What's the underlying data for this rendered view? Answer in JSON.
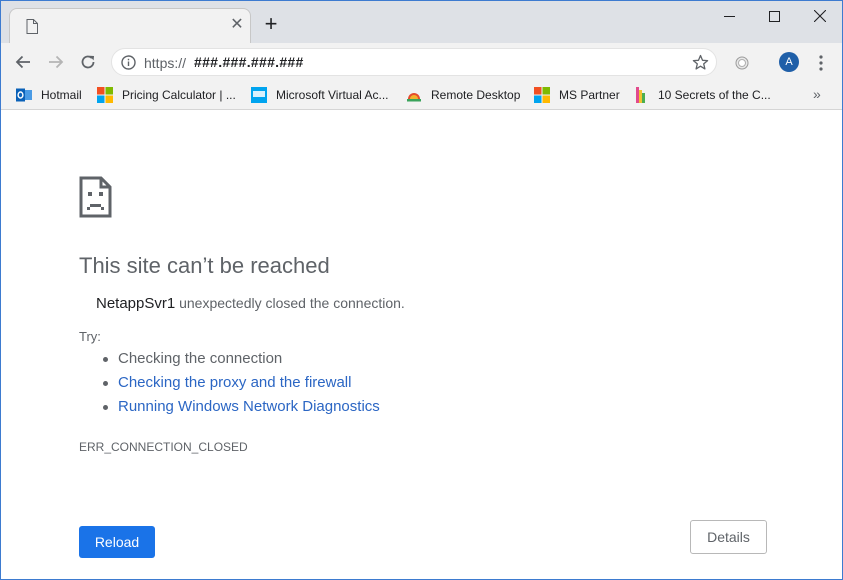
{
  "browser": {
    "tab": {
      "title": "",
      "favicon": "blank-page-icon"
    },
    "window_controls": [
      "minimize-icon",
      "maximize-icon",
      "close-icon"
    ],
    "omnibox": {
      "scheme": "https://",
      "host": "###.###.###.###"
    },
    "avatar_letter": "A",
    "accent": "#1a73e8"
  },
  "bookmarks": [
    {
      "label": "Hotmail",
      "icon": "outlook-icon"
    },
    {
      "label": "Pricing Calculator | ...",
      "icon": "microsoft-logo-icon"
    },
    {
      "label": "Microsoft Virtual Ac...",
      "icon": "mva-icon"
    },
    {
      "label": "Remote Desktop",
      "icon": "remote-desktop-icon"
    },
    {
      "label": "MS Partner",
      "icon": "microsoft-logo-icon"
    },
    {
      "label": "10 Secrets of the C...",
      "icon": "bookmark-page-icon"
    }
  ],
  "bookmarks_more": "»",
  "error": {
    "title": "This site can’t be reached",
    "host": "NetappSvr1",
    "message": " unexpectedly closed the connection.",
    "try_label": "Try:",
    "suggestions": [
      {
        "text": "Checking the connection",
        "link": false
      },
      {
        "text": "Checking the proxy and the firewall",
        "link": true
      },
      {
        "text": "Running Windows Network Diagnostics",
        "link": true
      }
    ],
    "code": "ERR_CONNECTION_CLOSED",
    "reload_label": "Reload",
    "details_label": "Details"
  }
}
